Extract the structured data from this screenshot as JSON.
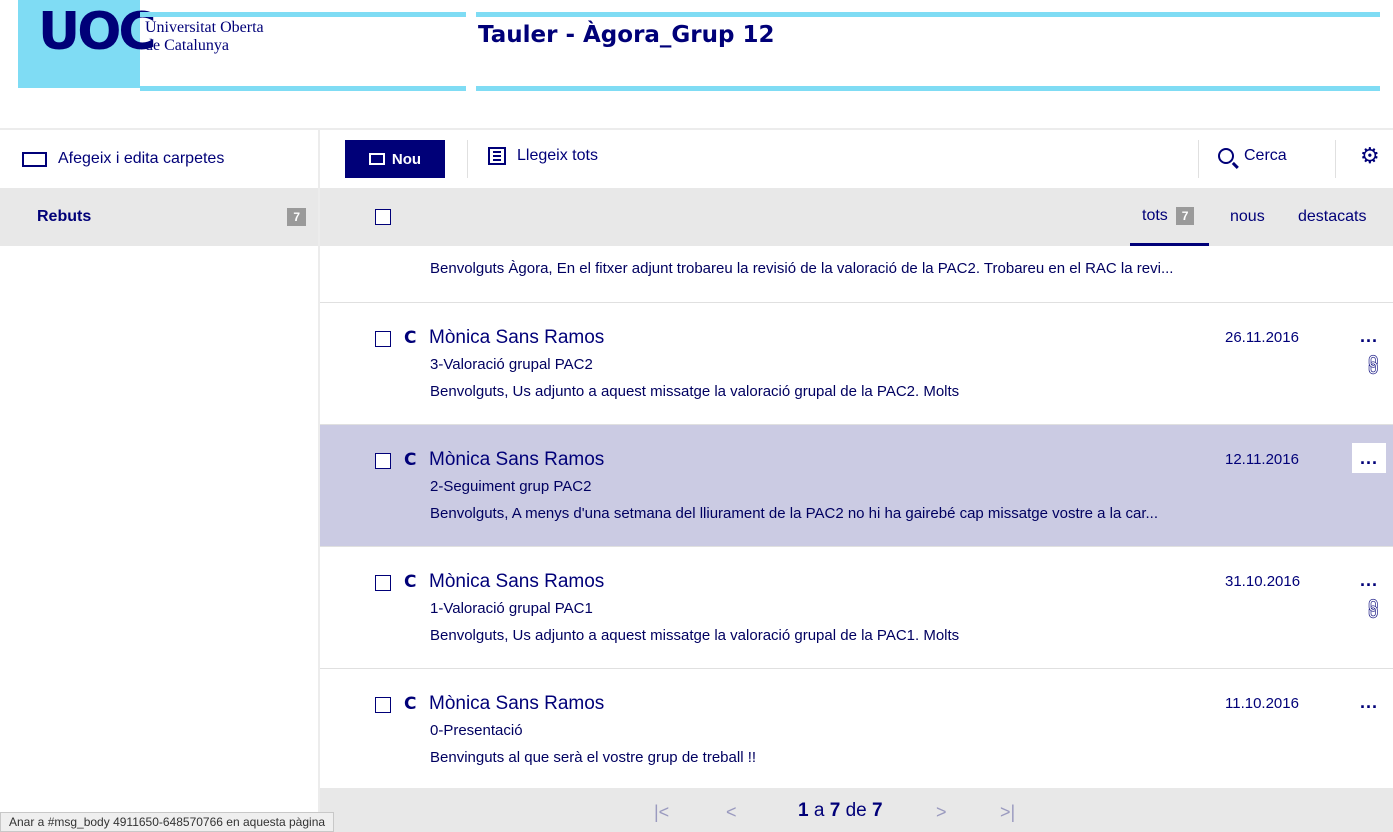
{
  "header": {
    "logo": "UOC",
    "university_line1": "Universitat Oberta",
    "university_line2": "de Catalunya",
    "page_title": "Tauler - Àgora_Grup 12"
  },
  "sidebar": {
    "edit_folders": "Afegeix i edita carpetes",
    "inbox_label": "Rebuts",
    "inbox_count": "7"
  },
  "toolbar": {
    "new_label": "Nou",
    "read_all_label": "Llegeix tots",
    "search_label": "Cerca"
  },
  "filters": {
    "all_label": "tots",
    "all_count": "7",
    "new_label": "nous",
    "starred_label": "destacats"
  },
  "partial_message": {
    "preview": "Benvolguts Àgora, En el fitxer adjunt trobareu la revisió de la valoració de la PAC2. Trobareu en el RAC la revi..."
  },
  "messages": [
    {
      "initial": "C",
      "sender": "Mònica Sans Ramos",
      "subject": "3-Valoració grupal PAC2",
      "preview": "Benvolguts,   Us adjunto a aquest missatge la valoració grupal de la PAC2. Molts",
      "date": "26.11.2016",
      "more": "...",
      "attachment": true
    },
    {
      "initial": "C",
      "sender": "Mònica Sans Ramos",
      "subject": "2-Seguiment grup PAC2",
      "preview": "Benvolguts,   A menys d'una setmana del lliurament de la PAC2 no hi ha gairebé cap missatge vostre a la car...",
      "date": "12.11.2016",
      "more": "...",
      "attachment": false
    },
    {
      "initial": "C",
      "sender": "Mònica Sans Ramos",
      "subject": "1-Valoració grupal PAC1",
      "preview": "Benvolguts,   Us adjunto a aquest missatge la valoració grupal de la PAC1. Molts",
      "date": "31.10.2016",
      "more": "...",
      "attachment": true
    },
    {
      "initial": "C",
      "sender": "Mònica Sans Ramos",
      "subject": "0-Presentació",
      "preview": "Benvinguts al que serà el vostre grup de treball !!",
      "date": "11.10.2016",
      "more": "...",
      "attachment": false
    }
  ],
  "pager": {
    "from": "1",
    "a": "a",
    "to": "7",
    "de": "de",
    "total": "7"
  },
  "status_bar": "Anar a #msg_body 4911650-648570766 en aquesta pàgina"
}
